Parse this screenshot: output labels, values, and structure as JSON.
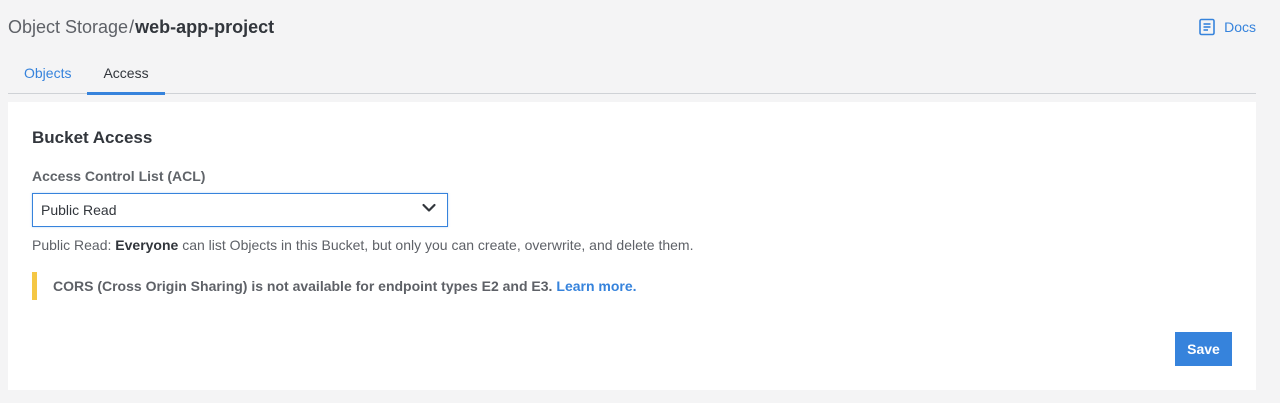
{
  "header": {
    "breadcrumb_parent": "Object Storage",
    "breadcrumb_separator": "/",
    "breadcrumb_current": "web-app-project",
    "docs_label": "Docs"
  },
  "tabs": [
    {
      "label": "Objects",
      "active": false
    },
    {
      "label": "Access",
      "active": true
    }
  ],
  "panel": {
    "title": "Bucket Access",
    "acl_label": "Access Control List (ACL)",
    "acl_value": "Public Read",
    "helper_prefix": "Public Read: ",
    "helper_bold": "Everyone",
    "helper_suffix": " can list Objects in this Bucket, but only you can create, overwrite, and delete them.",
    "notice_text": "CORS (Cross Origin Sharing) is not available for endpoint types E2 and E3.",
    "notice_link": "Learn more.",
    "save_label": "Save"
  },
  "colors": {
    "accent": "#3683dc",
    "warning": "#f5c744",
    "background": "#f4f4f5"
  },
  "icons": {
    "docs": "document-icon",
    "select": "chevron-down-icon"
  }
}
